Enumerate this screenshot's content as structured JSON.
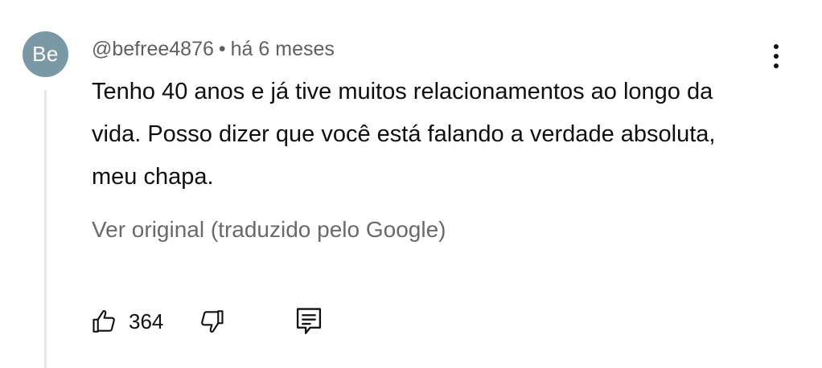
{
  "comment": {
    "avatar_initials": "Be",
    "author": "@befree4876",
    "separator": "•",
    "timestamp": "há 6 meses",
    "text": "Tenho 40 anos e já tive muitos relacionamentos ao longo da vida. Posso dizer que você está falando a verdade absoluta, meu chapa.",
    "translation_link": "Ver original (traduzido pelo Google)",
    "like_count": "364"
  },
  "icons": {
    "like": "thumbs-up-icon",
    "dislike": "thumbs-down-icon",
    "reply": "comment-reply-icon",
    "more": "more-vertical-icon"
  },
  "colors": {
    "avatar_background": "#7a98a5",
    "secondary_text": "#606060",
    "primary_text": "#0f0f0f"
  }
}
